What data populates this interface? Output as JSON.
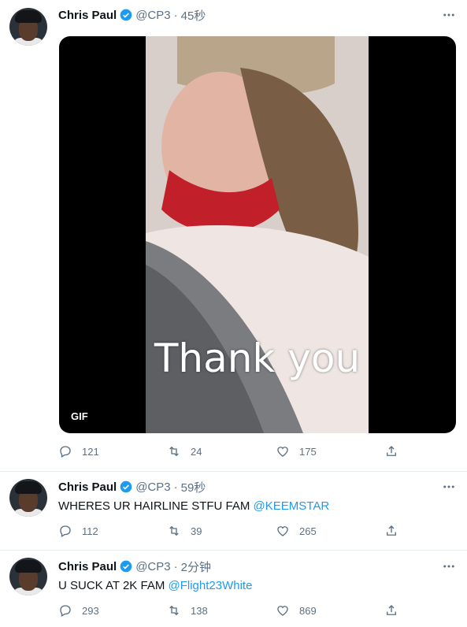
{
  "tweets": [
    {
      "name": "Chris Paul",
      "handle": "@CP3",
      "sep": "·",
      "time": "45秒",
      "text": "",
      "mention": "",
      "media": {
        "type_badge": "GIF",
        "caption": "Thank you"
      },
      "stats": {
        "replies": "121",
        "retweets": "24",
        "likes": "175"
      }
    },
    {
      "name": "Chris Paul",
      "handle": "@CP3",
      "sep": "·",
      "time": "59秒",
      "text": "WHERES UR HAIRLINE STFU FAM ",
      "mention": "@KEEMSTAR",
      "stats": {
        "replies": "112",
        "retweets": "39",
        "likes": "265"
      }
    },
    {
      "name": "Chris Paul",
      "handle": "@CP3",
      "sep": "·",
      "time": "2分钟",
      "text": "U SUCK AT 2K FAM ",
      "mention": "@Flight23White",
      "stats": {
        "replies": "293",
        "retweets": "138",
        "likes": "869"
      }
    }
  ],
  "colors": {
    "accent": "#1d9bf0",
    "secondary_text": "#5b7083",
    "border": "#e6ecf0"
  },
  "icons": [
    "verified-badge-icon",
    "more-icon",
    "reply-icon",
    "retweet-icon",
    "like-icon",
    "share-icon"
  ]
}
